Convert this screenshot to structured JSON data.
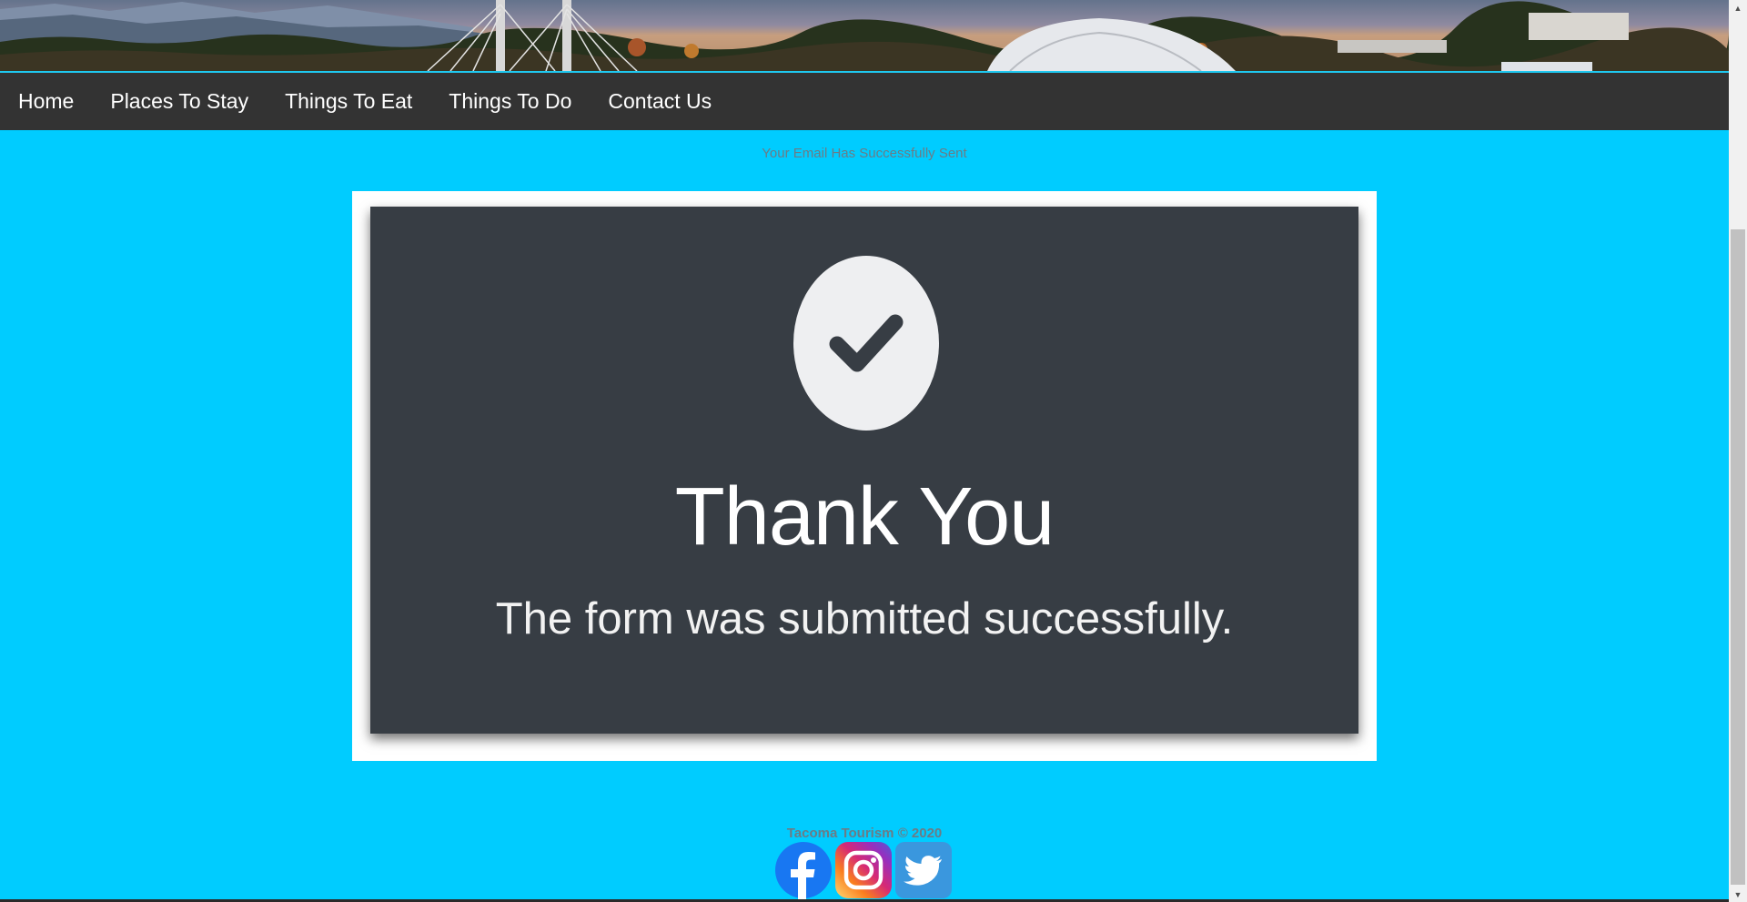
{
  "nav": {
    "items": [
      {
        "label": "Home"
      },
      {
        "label": "Places To Stay"
      },
      {
        "label": "Things To Eat"
      },
      {
        "label": "Things To Do"
      },
      {
        "label": "Contact Us"
      }
    ]
  },
  "status_message": "Your Email Has Successfully Sent",
  "confirmation": {
    "icon": "check-icon",
    "title": "Thank You",
    "subtitle": "The form was submitted successfully."
  },
  "footer": {
    "copyright": "Tacoma Tourism © 2020",
    "social": [
      {
        "icon": "facebook-icon"
      },
      {
        "icon": "instagram-icon"
      },
      {
        "icon": "twitter-icon"
      }
    ]
  },
  "colors": {
    "page_background": "#00ccff",
    "nav_background": "#333333",
    "card_background": "#373d44",
    "status_text": "#6b7c86"
  }
}
